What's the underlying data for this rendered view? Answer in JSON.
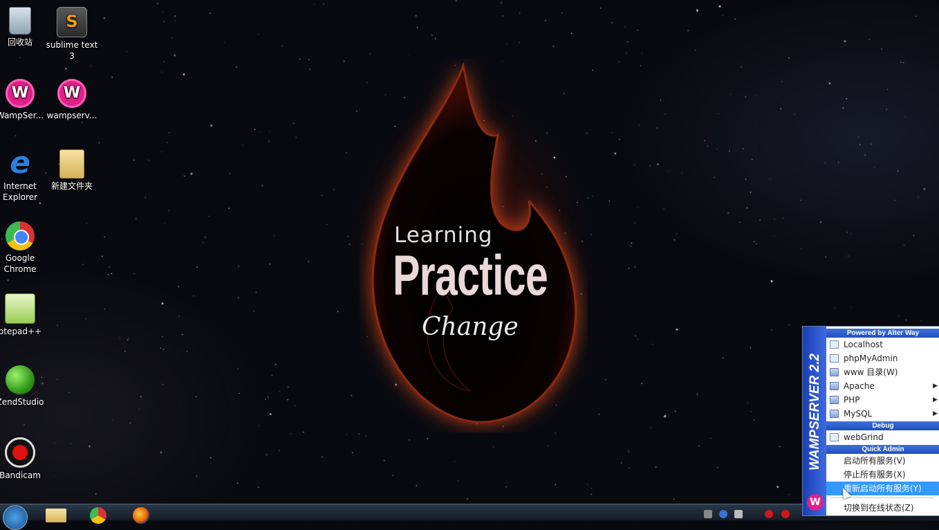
{
  "desktop_icons": [
    {
      "id": "recycle-bin",
      "label": "回收站",
      "icon": "recycle-bin-icon"
    },
    {
      "id": "sublime-text",
      "label": "sublime text 3",
      "icon": "sublime-text-icon"
    },
    {
      "id": "wampserver-1",
      "label": "WampSer...",
      "icon": "wampserver-icon"
    },
    {
      "id": "wampserver-2",
      "label": "wampserv...",
      "icon": "wampserver-icon"
    },
    {
      "id": "internet-explorer",
      "label": "Internet Explorer",
      "icon": "internet-explorer-icon"
    },
    {
      "id": "new-folder",
      "label": "新建文件夹",
      "icon": "folder-icon"
    },
    {
      "id": "google-chrome",
      "label": "Google Chrome",
      "icon": "chrome-icon"
    },
    {
      "id": "notepadpp",
      "label": "otepad++",
      "icon": "notepadpp-icon"
    },
    {
      "id": "zendstudio",
      "label": "ZendStudio",
      "icon": "zendstudio-icon"
    },
    {
      "id": "bandicam",
      "label": "Bandicam",
      "icon": "bandicam-icon"
    }
  ],
  "wallpaper": {
    "learning": "Learning",
    "practice": "Practice",
    "change": "Change"
  },
  "wamp_menu": {
    "side_title": "WAMPSERVER 2.2",
    "logo_letter": "W",
    "header_powered": "Powered by Alter Way",
    "items_main": [
      {
        "label": "Localhost",
        "icon": "page-icon",
        "submenu": false
      },
      {
        "label": "phpMyAdmin",
        "icon": "page-icon",
        "submenu": false
      },
      {
        "label": "www 目录(W)",
        "icon": "folder-icon",
        "submenu": false
      },
      {
        "label": "Apache",
        "icon": "folder-icon",
        "submenu": true
      },
      {
        "label": "PHP",
        "icon": "folder-icon",
        "submenu": true
      },
      {
        "label": "MySQL",
        "icon": "folder-icon",
        "submenu": true
      }
    ],
    "header_debug": "Debug",
    "items_debug": [
      {
        "label": "webGrind",
        "icon": "page-icon"
      }
    ],
    "header_quick": "Quick Admin",
    "items_quick": [
      {
        "label": "启动所有服务(V)"
      },
      {
        "label": "停止所有服务(X)"
      },
      {
        "label": "重新启动所有服务(Y)",
        "highlighted": true
      }
    ],
    "item_last": "切换到在线状态(Z)",
    "submenu_arrow": "▶"
  },
  "taskbar": {
    "pinned": [
      "start-button",
      "explorer-icon",
      "chrome-icon",
      "firefox-icon"
    ]
  },
  "colors": {
    "wamp_blue": "#2050c0",
    "highlight": "#3399ff",
    "wamp_pink": "#e0218a"
  }
}
